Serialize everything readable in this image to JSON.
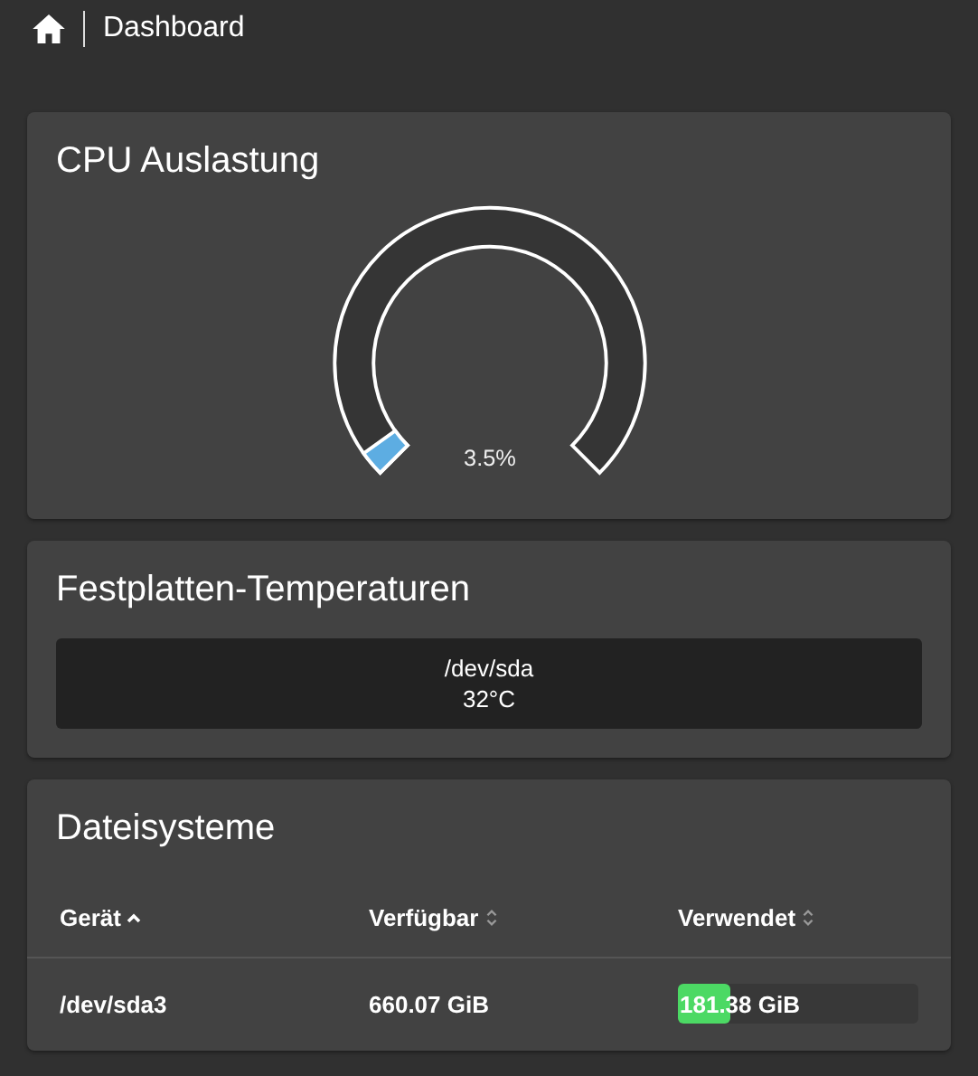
{
  "header": {
    "title": "Dashboard"
  },
  "cpu": {
    "title": "CPU Auslastung",
    "reading": "3.5%"
  },
  "temperatures": {
    "title": "Festplatten-Temperaturen",
    "disks": [
      {
        "device": "/dev/sda",
        "temperature": "32°C"
      }
    ]
  },
  "filesystems": {
    "title": "Dateisysteme",
    "columns": [
      {
        "label": "Gerät",
        "sorted": true
      },
      {
        "label": "Verfügbar",
        "sorted": false
      },
      {
        "label": "Verwendet",
        "sorted": false
      }
    ],
    "rows": [
      {
        "device": "/dev/sda3",
        "available": "660.07 GiB",
        "used": "181.38 GiB",
        "level": 0.2156
      }
    ]
  }
}
